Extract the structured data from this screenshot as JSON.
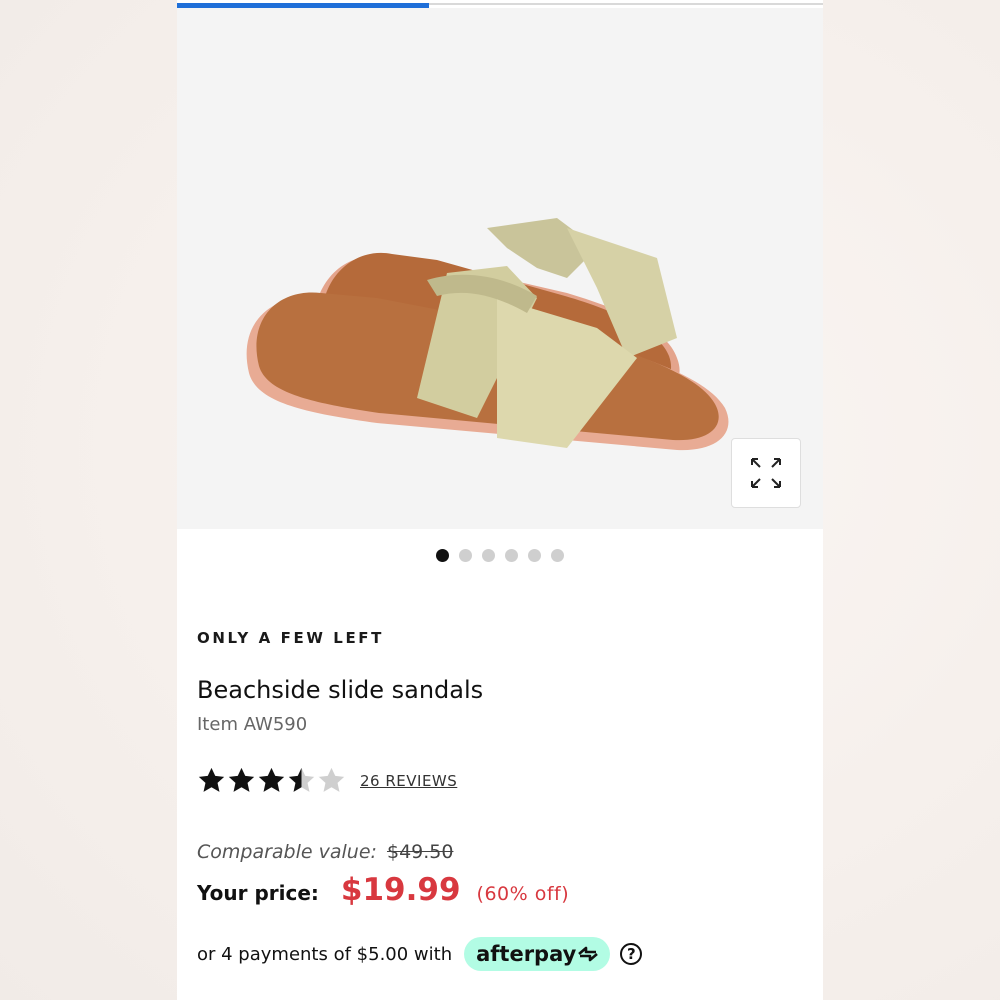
{
  "gallery": {
    "progress_fraction": 0.39,
    "image_count": 6,
    "active_index": 0,
    "expand_icon": "expand-arrows-icon"
  },
  "product": {
    "stock_badge": "ONLY A FEW LEFT",
    "title": "Beachside slide sandals",
    "item_number": "Item AW590",
    "rating": 3.5,
    "rating_max": 5,
    "reviews_label": "26 REVIEWS"
  },
  "pricing": {
    "comparable_label": "Comparable value:",
    "comparable_price": "$49.50",
    "your_price_label": "Your price:",
    "your_price": "$19.99",
    "discount": "(60% off)"
  },
  "afterpay": {
    "text": "or 4 payments of $5.00 with",
    "brand": "afterpay",
    "help_icon": "question-circle-icon"
  },
  "colors": {
    "accent_red": "#d8383f",
    "progress_blue": "#1f6fd8",
    "afterpay_mint": "#b2fce4"
  }
}
